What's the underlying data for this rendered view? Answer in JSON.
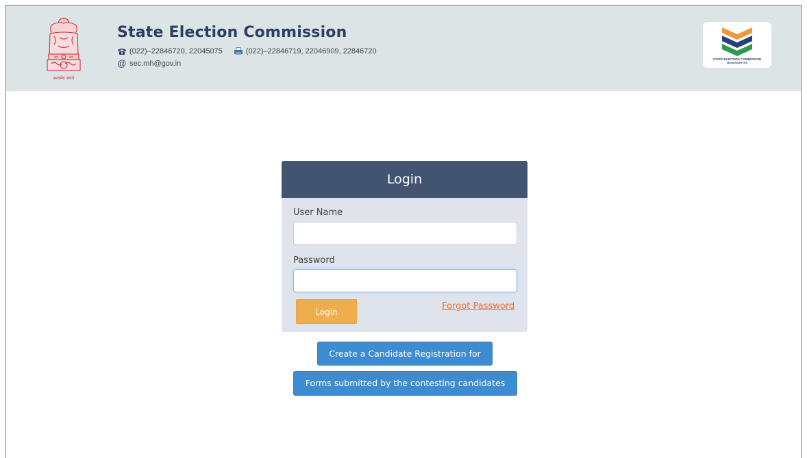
{
  "header": {
    "title": "State Election Commission",
    "phone": "(022)–22846720, 22045075",
    "fax": "(022)–22846719, 22046909, 22846720",
    "email": "sec.mh@gov.in",
    "emblem_caption": "सत्यमेव जयते",
    "logo_line1": "STATE ELECTION COMMISSION",
    "logo_line2": "MAHARASHTRA",
    "icons": {
      "phone": "telephone-icon",
      "fax": "fax-icon",
      "email": "at-icon"
    },
    "colors": {
      "header_bg": "#dde4e6",
      "title": "#2c3e63",
      "saffron": "#f0973a",
      "green": "#2e9a4b",
      "navy": "#26407a"
    }
  },
  "login": {
    "heading": "Login",
    "username_label": "User Name",
    "username_value": "",
    "password_label": "Password",
    "password_value": "",
    "login_button": "Login",
    "forgot_link": "Forgot Password",
    "colors": {
      "header_bg": "#42546f",
      "panel_bg": "#dfe4ec",
      "login_btn": "#f0ad4e",
      "forgot": "#e8703a"
    }
  },
  "actions": {
    "create_registration": "Create a Candidate Registration for",
    "forms_submitted": "Forms submitted by the contesting candidates",
    "colors": {
      "button": "#3d8bd0"
    }
  }
}
